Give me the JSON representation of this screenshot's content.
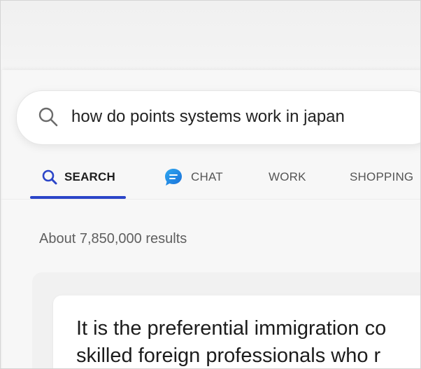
{
  "search": {
    "query": "how do points systems work in japan"
  },
  "tabs": [
    {
      "label": "SEARCH",
      "active": true,
      "icon": "search-icon"
    },
    {
      "label": "CHAT",
      "active": false,
      "icon": "chat-bubble-icon"
    },
    {
      "label": "WORK",
      "active": false
    },
    {
      "label": "SHOPPING",
      "active": false
    }
  ],
  "results": {
    "count_text": "About 7,850,000 results"
  },
  "answer": {
    "line1": "It is the preferential immigration co",
    "line2": "skilled foreign professionals who r"
  },
  "colors": {
    "accent": "#2b45c8",
    "chat_icon": "#1f8ee8"
  }
}
